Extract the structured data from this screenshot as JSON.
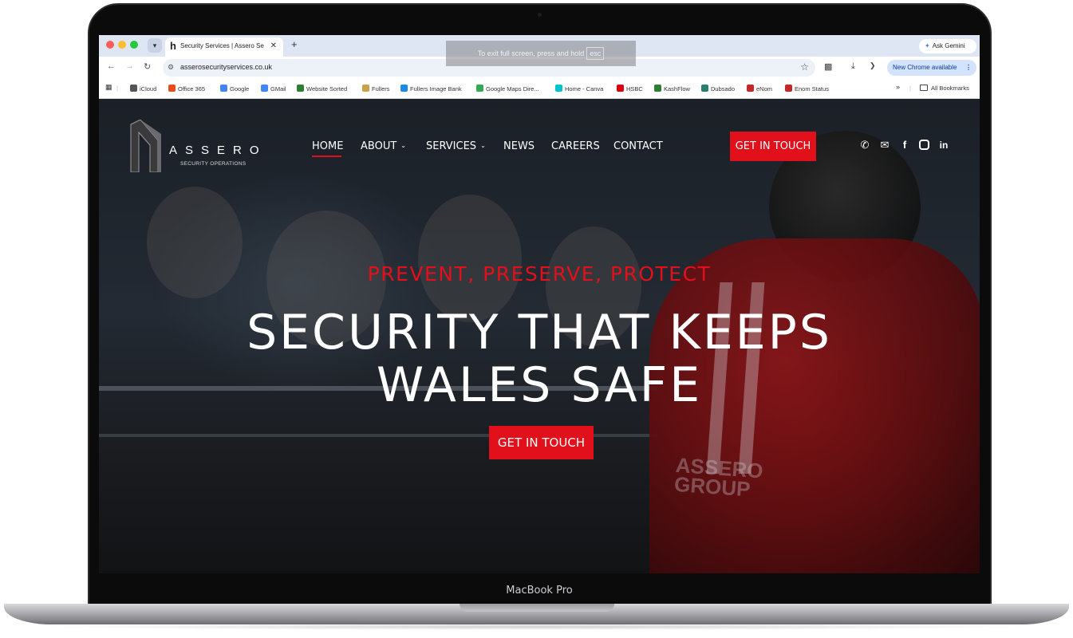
{
  "device": {
    "label": "MacBook Pro"
  },
  "browser": {
    "tab": {
      "title": "Security Services | Assero Se",
      "favicon": "h"
    },
    "new_tab_label": "+",
    "gemini_label": "Ask Gemini",
    "address": "asserosecurityservices.co.uk",
    "update_label": "New Chrome available",
    "fullscreen_toast": {
      "text": "To exit full screen, press and hold",
      "key": "esc"
    },
    "bookmarks": [
      {
        "label": "iCloud",
        "color": "#555555"
      },
      {
        "label": "Office 365",
        "color": "#e74c1b"
      },
      {
        "label": "Google",
        "color": "#4285f4"
      },
      {
        "label": "GMail",
        "color": "#4285f4"
      },
      {
        "label": "Website Sorted",
        "color": "#2e7d32"
      },
      {
        "label": "Fullers",
        "color": "#c8a14a"
      },
      {
        "label": "Fullers Image Bank",
        "color": "#1e88e5"
      },
      {
        "label": "Google Maps Dire...",
        "color": "#34a853"
      },
      {
        "label": "Home - Canva",
        "color": "#00c4cc"
      },
      {
        "label": "HSBC",
        "color": "#db0011"
      },
      {
        "label": "KashFlow",
        "color": "#2e7d32"
      },
      {
        "label": "Dubsado",
        "color": "#2a7f6f"
      },
      {
        "label": "eNom",
        "color": "#c62828"
      },
      {
        "label": "Enom Status",
        "color": "#c62828"
      }
    ],
    "bookmarks_overflow": "»",
    "all_bookmarks": "All Bookmarks"
  },
  "site": {
    "logo": {
      "word": "ASSERO",
      "sub": "SECURITY OPERATIONS"
    },
    "nav": [
      {
        "label": "HOME",
        "active": true
      },
      {
        "label": "ABOUT",
        "dropdown": true
      },
      {
        "label": "SERVICES",
        "dropdown": true
      },
      {
        "label": "NEWS"
      },
      {
        "label": "CAREERS"
      },
      {
        "label": "CONTACT"
      }
    ],
    "header_cta": "GET IN TOUCH",
    "social_icons": [
      "phone-icon",
      "email-icon",
      "facebook-icon",
      "instagram-icon",
      "linkedin-icon"
    ],
    "accent_color": "#e2101b",
    "hero": {
      "tagline": "PREVENT, PRESERVE, PROTECT",
      "headline_line1": "SECURITY THAT KEEPS",
      "headline_line2": "WALES SAFE",
      "cta": "GET IN TOUCH",
      "vest_text": "ASSERO GROUP"
    }
  }
}
